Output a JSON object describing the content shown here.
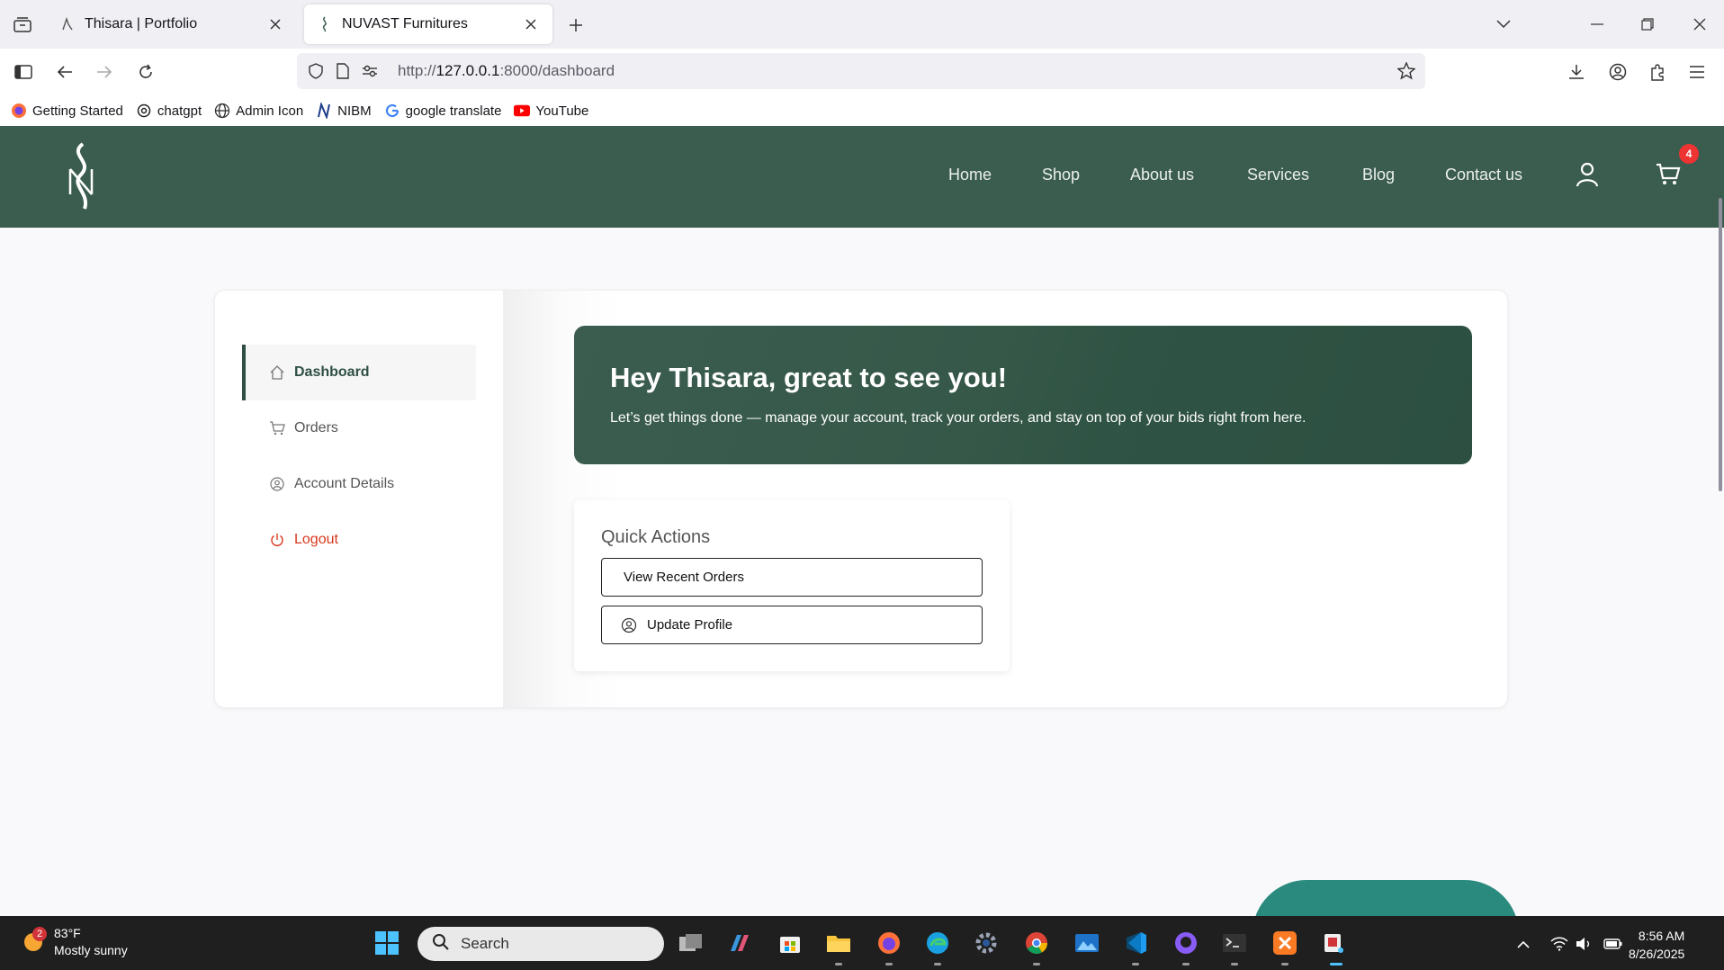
{
  "browser": {
    "tabs": [
      {
        "title": "Thisara | Portfolio",
        "active": false
      },
      {
        "title": "NUVAST Furnitures",
        "active": true
      }
    ],
    "url_scheme": "http://",
    "url_host": "127.0.0.1",
    "url_rest": ":8000/dashboard",
    "bookmarks": [
      "Getting Started",
      "chatgpt",
      "Admin Icon",
      "NIBM",
      "google translate",
      "YouTube"
    ]
  },
  "site": {
    "brand_color": "#3b5d50",
    "nav": [
      "Home",
      "Shop",
      "About us",
      "Services",
      "Blog",
      "Contact us"
    ],
    "cart_count": "4"
  },
  "sidebar": {
    "items": [
      {
        "label": "Dashboard",
        "icon": "home-icon",
        "active": true
      },
      {
        "label": "Orders",
        "icon": "cart-icon",
        "active": false
      },
      {
        "label": "Account Details",
        "icon": "user-circle-icon",
        "active": false
      },
      {
        "label": "Logout",
        "icon": "power-icon",
        "active": false
      }
    ]
  },
  "hero": {
    "heading": "Hey Thisara, great to see you!",
    "text": "Let’s get things done — manage your account, track your orders, and stay on top of your bids right from here."
  },
  "quick_actions": {
    "title": "Quick Actions",
    "buttons": [
      "View Recent Orders",
      "Update Profile"
    ]
  },
  "taskbar": {
    "weather_badge": "2",
    "temperature": "83°F",
    "condition": "Mostly sunny",
    "search_placeholder": "Search",
    "time": "8:56 AM",
    "date": "8/26/2025"
  }
}
